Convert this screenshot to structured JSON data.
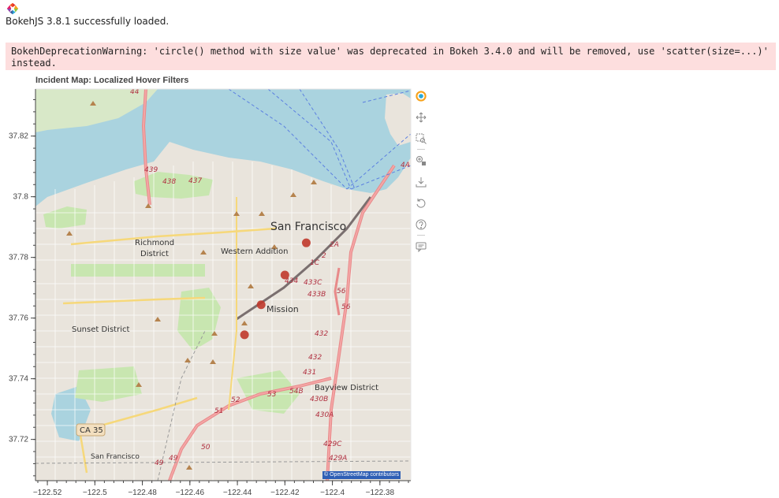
{
  "header": {
    "loaded_message": "BokehJS 3.8.1 successfully loaded.",
    "warning_text": "BokehDeprecationWarning: 'circle() method with size value' was deprecated in Bokeh 3.4.0 and will be removed, use 'scatter(size=...)' instead."
  },
  "map_labels": {
    "city": "San Francisco",
    "richmond_1": "Richmond",
    "richmond_2": "District",
    "western_addition": "Western Addition",
    "mission": "Mission",
    "sunset": "Sunset District",
    "bayview": "Bayview District",
    "ca35": "CA 35",
    "south_sf": "San Francisco",
    "roads": [
      "439",
      "438",
      "437",
      "1C",
      "2",
      "2A",
      "434",
      "433C",
      "433B",
      "56",
      "56",
      "432",
      "432",
      "431",
      "54B",
      "53",
      "430B",
      "430A",
      "52",
      "51",
      "50",
      "49",
      "49",
      "429C",
      "429A",
      "4A",
      "44"
    ]
  },
  "attribution": "© OpenStreetMap contributors",
  "colors": {
    "marker": "#c0392b",
    "warning_bg": "#fddede",
    "water": "#aad3df",
    "land": "#f2efe9",
    "park": "#c8e6b0"
  },
  "toolbar": {
    "tools": [
      "bokeh-logo-icon",
      "pan-icon",
      "box-zoom-icon",
      "wheel-zoom-icon",
      "save-icon",
      "reset-icon",
      "help-icon",
      "hover-icon"
    ]
  },
  "chart_data": {
    "type": "scatter",
    "title": "Incident Map: Localized Hover Filters",
    "xlabel": "",
    "ylabel": "",
    "xlim": [
      -122.525,
      -122.367
    ],
    "ylim": [
      37.7064,
      37.8355
    ],
    "x_ticks": [
      -122.52,
      -122.5,
      -122.48,
      -122.46,
      -122.44,
      -122.42,
      -122.4,
      -122.38
    ],
    "x_tick_labels": [
      "−122.52",
      "−122.5",
      "−122.48",
      "−122.46",
      "−122.44",
      "−122.42",
      "−122.4",
      "−122.38"
    ],
    "y_ticks": [
      37.72,
      37.74,
      37.76,
      37.78,
      37.8,
      37.82
    ],
    "y_tick_labels": [
      "37.72",
      "37.74",
      "37.76",
      "37.78",
      "37.8",
      "37.82"
    ],
    "series": [
      {
        "x": [
          -122.411,
          -122.42,
          -122.43,
          -122.437
        ],
        "y": [
          37.7848,
          37.7742,
          37.7644,
          37.7545
        ]
      }
    ],
    "background": "OpenStreetMap tiles",
    "grid": false
  }
}
